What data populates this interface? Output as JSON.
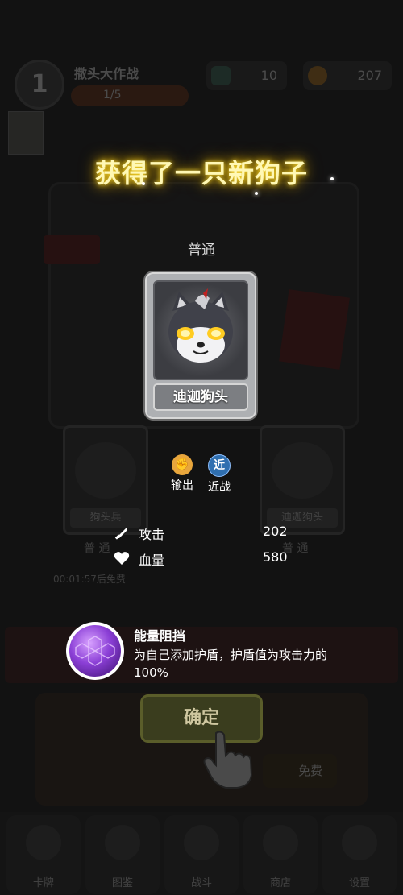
{
  "background": {
    "player": {
      "level": "1",
      "name": "撒头大作战",
      "progress_text": "1/5"
    },
    "resources": [
      {
        "icon": "gem-icon",
        "value": "10",
        "color": "#3c6e5a"
      },
      {
        "icon": "coin-icon",
        "value": "207",
        "color": "#b5751a"
      }
    ],
    "cards": [
      {
        "name": "狗头兵",
        "rank": "普 通"
      },
      {
        "name": "迪迦狗头",
        "rank": "普 通"
      }
    ],
    "timer": "00:01:57后免费",
    "free_button": "免费",
    "nav": [
      "卡牌",
      "图鉴",
      "战斗",
      "商店",
      "设置"
    ]
  },
  "popup": {
    "title": "获得了一只新狗子",
    "rarity": "普通",
    "card_name": "迪迦狗头",
    "tags": [
      {
        "icon": "fist-icon",
        "label": "输出",
        "color": "#e8a63c"
      },
      {
        "icon": "near-icon",
        "glyph": "近",
        "label": "近战",
        "color": "#2f6fb0"
      }
    ],
    "stats": [
      {
        "icon": "sword-icon",
        "name": "攻击",
        "value": "202"
      },
      {
        "icon": "heart-icon",
        "name": "血量",
        "value": "580"
      }
    ],
    "skill": {
      "name": "能量阻挡",
      "description": "为自己添加护盾，护盾值为攻击力的100%"
    },
    "confirm_label": "确定"
  }
}
